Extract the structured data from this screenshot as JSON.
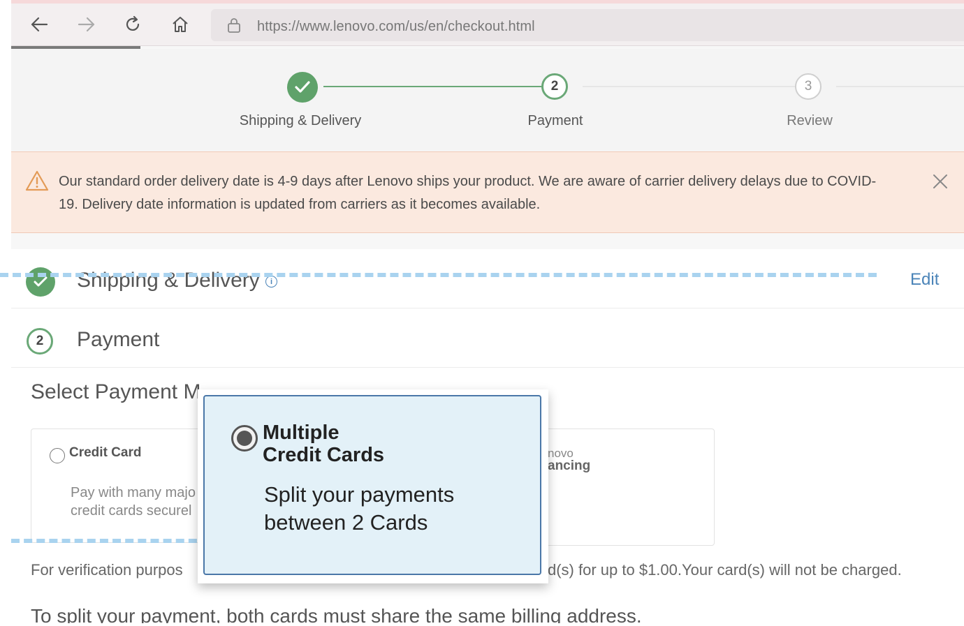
{
  "browser": {
    "url": "https://www.lenovo.com/us/en/checkout.html"
  },
  "stepper": {
    "steps": [
      {
        "number": "",
        "label": "Shipping & Delivery",
        "state": "done"
      },
      {
        "number": "2",
        "label": "Payment",
        "state": "active"
      },
      {
        "number": "3",
        "label": "Review",
        "state": "pending"
      }
    ]
  },
  "alert": {
    "text": "Our standard order delivery date is 4-9 days after Lenovo ships your product. We are aware of carrier delivery delays due to COVID-19. Delivery date information is updated from carriers as it becomes available."
  },
  "shipping_section": {
    "title": "Shipping & Delivery",
    "info_glyph": "i",
    "edit_label": "Edit"
  },
  "payment_section": {
    "number": "2",
    "title": "Payment"
  },
  "payment_methods": {
    "heading": "Select Payment M",
    "credit_card_label": "Credit Card",
    "credit_card_desc": "Pay with many majo credit cards securel",
    "financing_line1": "novo",
    "financing_line2": "ancing"
  },
  "verification": {
    "left": "For verification purpos",
    "right": "d(s) for up to $1.00.Your card(s) will not be charged."
  },
  "split_note": "To split your payment, both cards must share the same billing address.",
  "popup": {
    "title_line1": "Multiple",
    "title_line2": "Credit Cards",
    "desc_line1": "Split your payments",
    "desc_line2": "between 2 Cards"
  },
  "colors": {
    "green": "#5fa26a",
    "link_blue": "#4b84b8",
    "alert_bg": "#fbe9df",
    "popup_bg": "#e3f1f8",
    "dash_blue": "#a9d3ef"
  }
}
